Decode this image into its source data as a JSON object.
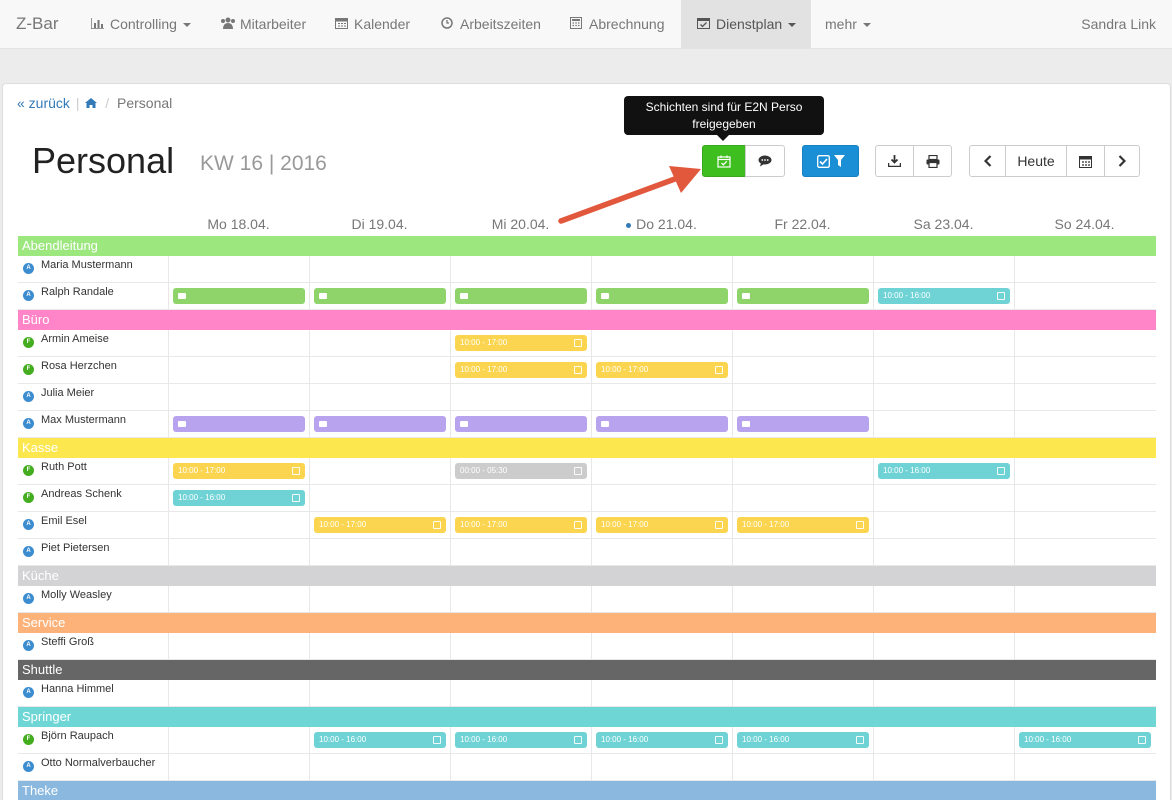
{
  "navbar": {
    "brand": "Z-Bar",
    "items": [
      {
        "label": "Controlling",
        "icon": "bar-chart-icon",
        "dropdown": true
      },
      {
        "label": "Mitarbeiter",
        "icon": "users-icon",
        "dropdown": false
      },
      {
        "label": "Kalender",
        "icon": "calendar-icon",
        "dropdown": false
      },
      {
        "label": "Arbeitszeiten",
        "icon": "clock-icon",
        "dropdown": false
      },
      {
        "label": "Abrechnung",
        "icon": "calculator-icon",
        "dropdown": false
      },
      {
        "label": "Dienstplan",
        "icon": "calendar-check-icon",
        "dropdown": true,
        "active": true
      },
      {
        "label": "mehr",
        "icon": "",
        "dropdown": true
      }
    ],
    "user": "Sandra Link"
  },
  "breadcrumb": {
    "back": "« zurück",
    "separator": "/",
    "current": "Personal"
  },
  "page": {
    "title": "Personal",
    "subtitle": "KW 16 | 2016"
  },
  "tooltip": {
    "text": "Schichten sind für E2N Perso freigegeben"
  },
  "toolbar": {
    "today_label": "Heute"
  },
  "colors": {
    "green": "#3fbf1f",
    "blue": "#1b8fd6",
    "shift_green": "#8fd46a",
    "shift_yellow": "#fbd54f",
    "shift_teal": "#6fd3d6",
    "shift_purple": "#b8a4ee",
    "shift_gray": "#cccccc",
    "badge_A": "#3c8dcf",
    "badge_F": "#43ac1f"
  },
  "days": [
    "Mo 18.04.",
    "Di 19.04.",
    "Mi 20.04.",
    "Do 21.04.",
    "Fr 22.04.",
    "Sa 23.04.",
    "So 24.04."
  ],
  "today_index": 3,
  "groups": [
    {
      "name": "Abendleitung",
      "color": "#9de77f",
      "rows": [
        {
          "name": "Maria Mustermann",
          "badge": "A",
          "shifts": []
        },
        {
          "name": "Ralph Randale",
          "badge": "A",
          "shifts": [
            {
              "day": 0,
              "type": "vacation",
              "color": "shift_green"
            },
            {
              "day": 1,
              "type": "vacation",
              "color": "shift_green"
            },
            {
              "day": 2,
              "type": "vacation",
              "color": "shift_green"
            },
            {
              "day": 3,
              "type": "vacation",
              "color": "shift_green"
            },
            {
              "day": 4,
              "type": "vacation",
              "color": "shift_green"
            },
            {
              "day": 5,
              "label": "10:00 - 16:00",
              "color": "shift_teal"
            }
          ]
        }
      ]
    },
    {
      "name": "Büro",
      "color": "#ff85c8",
      "rows": [
        {
          "name": "Armin Ameise",
          "badge": "F",
          "shifts": [
            {
              "day": 2,
              "label": "10:00 - 17:00",
              "color": "shift_yellow"
            }
          ]
        },
        {
          "name": "Rosa Herzchen",
          "badge": "F",
          "shifts": [
            {
              "day": 2,
              "label": "10:00 - 17:00",
              "color": "shift_yellow"
            },
            {
              "day": 3,
              "label": "10:00 - 17:00",
              "color": "shift_yellow"
            }
          ]
        },
        {
          "name": "Julia Meier",
          "badge": "A",
          "shifts": []
        },
        {
          "name": "Max Mustermann",
          "badge": "A",
          "shifts": [
            {
              "day": 0,
              "type": "book",
              "color": "shift_purple"
            },
            {
              "day": 1,
              "type": "book",
              "color": "shift_purple"
            },
            {
              "day": 2,
              "type": "book",
              "color": "shift_purple"
            },
            {
              "day": 3,
              "type": "book",
              "color": "shift_purple"
            },
            {
              "day": 4,
              "type": "book",
              "color": "shift_purple"
            }
          ]
        }
      ]
    },
    {
      "name": "Kasse",
      "color": "#fde74f",
      "rows": [
        {
          "name": "Ruth Pott",
          "badge": "F",
          "shifts": [
            {
              "day": 0,
              "label": "10:00 - 17:00",
              "color": "shift_yellow"
            },
            {
              "day": 2,
              "label": "00:00 - 05:30",
              "color": "shift_gray"
            },
            {
              "day": 5,
              "label": "10:00 - 16:00",
              "color": "shift_teal"
            }
          ]
        },
        {
          "name": "Andreas Schenk",
          "badge": "F",
          "shifts": [
            {
              "day": 0,
              "label": "10:00 - 16:00",
              "color": "shift_teal"
            }
          ]
        },
        {
          "name": "Emil Esel",
          "badge": "A",
          "shifts": [
            {
              "day": 1,
              "label": "10:00 - 17:00",
              "color": "shift_yellow"
            },
            {
              "day": 2,
              "label": "10:00 - 17:00",
              "color": "shift_yellow"
            },
            {
              "day": 3,
              "label": "10:00 - 17:00",
              "color": "shift_yellow"
            },
            {
              "day": 4,
              "label": "10:00 - 17:00",
              "color": "shift_yellow"
            }
          ]
        },
        {
          "name": "Piet Pietersen",
          "badge": "A",
          "shifts": []
        }
      ]
    },
    {
      "name": "Küche",
      "color": "#d3d3d6",
      "rows": [
        {
          "name": "Molly Weasley",
          "badge": "A",
          "shifts": []
        }
      ]
    },
    {
      "name": "Service",
      "color": "#fdb27a",
      "rows": [
        {
          "name": "Steffi Groß",
          "badge": "A",
          "shifts": []
        }
      ]
    },
    {
      "name": "Shuttle",
      "color": "#666666",
      "rows": [
        {
          "name": "Hanna Himmel",
          "badge": "A",
          "shifts": []
        }
      ]
    },
    {
      "name": "Springer",
      "color": "#6fd6d6",
      "rows": [
        {
          "name": "Björn Raupach",
          "badge": "F",
          "shifts": [
            {
              "day": 1,
              "label": "10:00 - 16:00",
              "color": "shift_teal"
            },
            {
              "day": 2,
              "label": "10:00 - 16:00",
              "color": "shift_teal"
            },
            {
              "day": 3,
              "label": "10:00 - 16:00",
              "color": "shift_teal"
            },
            {
              "day": 4,
              "label": "10:00 - 16:00",
              "color": "shift_teal"
            },
            {
              "day": 6,
              "label": "10:00 - 16:00",
              "color": "shift_teal"
            }
          ]
        },
        {
          "name": "Otto Normalverbaucher",
          "badge": "A",
          "shifts": []
        }
      ]
    },
    {
      "name": "Theke",
      "color": "#8ab8de",
      "rows": []
    }
  ]
}
